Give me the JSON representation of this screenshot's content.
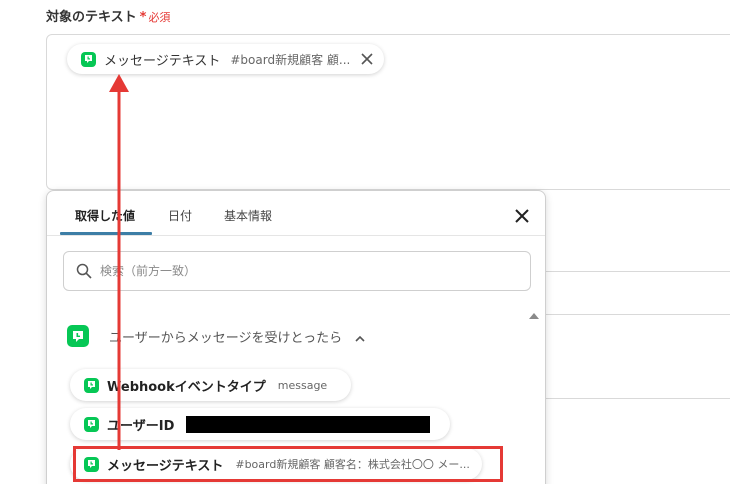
{
  "field": {
    "label": "対象のテキスト",
    "required_star": "*",
    "required_text": "必須"
  },
  "selected_chip": {
    "label": "メッセージテキスト",
    "value": "#board新規顧客 顧...",
    "icon": "line-app-icon"
  },
  "popup": {
    "tabs": [
      {
        "label": "取得した値",
        "active": true
      },
      {
        "label": "日付",
        "active": false
      },
      {
        "label": "基本情報",
        "active": false
      }
    ],
    "search_placeholder": "検索（前方一致）",
    "group": {
      "title": "ユーザーからメッセージを受けとったら",
      "icon": "line-app-icon",
      "expanded": true
    },
    "items": [
      {
        "label": "Webhookイベントタイプ",
        "value": "message"
      },
      {
        "label": "ユーザーID",
        "value": "",
        "redacted": true
      },
      {
        "label": "メッセージテキスト",
        "value": "#board新規顧客 顧客名：株式会社〇〇 メー..."
      }
    ]
  },
  "colors": {
    "accent_green": "#06c755",
    "highlight_red": "#e53935",
    "tab_underline": "#3d7ea6"
  }
}
